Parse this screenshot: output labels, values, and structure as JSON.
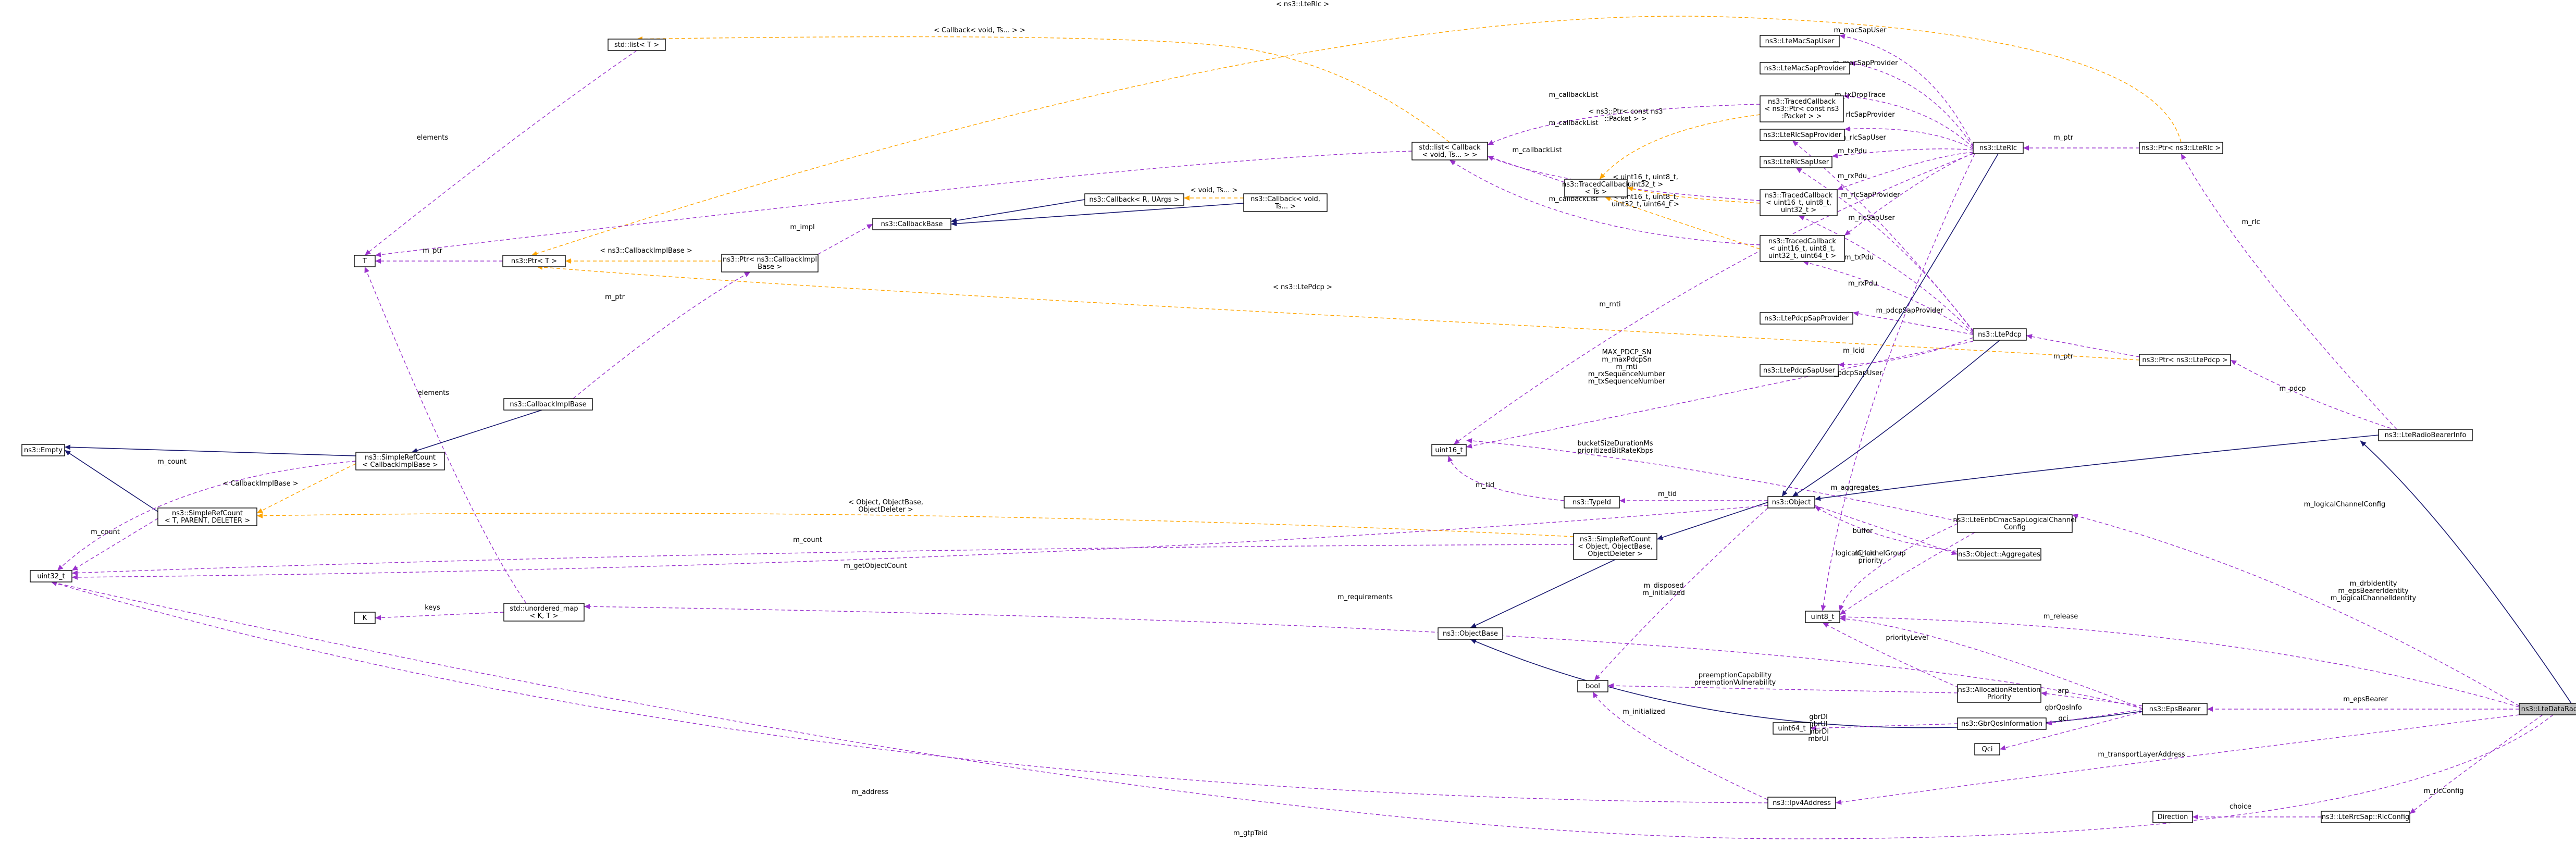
{
  "colors": {
    "usage_edge": "#9a32cd",
    "template_edge": "#ffa500",
    "inheritance_edge": "#191970",
    "highlight_fill": "#bfbfbf"
  },
  "nodes": [
    {
      "id": "uint32_t",
      "label": [
        "uint32_t"
      ]
    },
    {
      "id": "Empty",
      "label": [
        "ns3::Empty"
      ]
    },
    {
      "id": "SRC_generic",
      "label": [
        "ns3::SimpleRefCount",
        "< T, PARENT, DELETER >"
      ]
    },
    {
      "id": "K",
      "label": [
        "K"
      ]
    },
    {
      "id": "T",
      "label": [
        "T"
      ]
    },
    {
      "id": "stdlistT",
      "label": [
        "std::list< T >"
      ]
    },
    {
      "id": "PtrT",
      "label": [
        "ns3::Ptr< T >"
      ]
    },
    {
      "id": "unorderedmap",
      "label": [
        "std::unordered_map",
        "< K, T >"
      ]
    },
    {
      "id": "CBImplBase",
      "label": [
        "ns3::CallbackImplBase"
      ]
    },
    {
      "id": "SRC_CBImpl",
      "label": [
        "ns3::SimpleRefCount",
        "< CallbackImplBase >"
      ]
    },
    {
      "id": "PtrCBImpl",
      "label": [
        "ns3::Ptr< ns3::CallbackImpl",
        "Base >"
      ]
    },
    {
      "id": "CBBase",
      "label": [
        "ns3::CallbackBase"
      ]
    },
    {
      "id": "CallbackRU",
      "label": [
        "ns3::Callback< R, UArgs >"
      ]
    },
    {
      "id": "CallbackVoid",
      "label": [
        "ns3::Callback< void,",
        "Ts... >"
      ]
    },
    {
      "id": "stdlistCB",
      "label": [
        "std::list< Callback",
        "< void, Ts... > >"
      ]
    },
    {
      "id": "TCbTs",
      "label": [
        "ns3::TracedCallback",
        "< Ts >"
      ]
    },
    {
      "id": "LteMacSapUser",
      "label": [
        "ns3::LteMacSapUser"
      ]
    },
    {
      "id": "LteMacSapProvider",
      "label": [
        "ns3::LteMacSapProvider"
      ]
    },
    {
      "id": "TCbPacket",
      "label": [
        "ns3::TracedCallback",
        "< ns3::Ptr< const ns3",
        ":Packet > >"
      ]
    },
    {
      "id": "LteRlcSapProvider",
      "label": [
        "ns3::LteRlcSapProvider"
      ]
    },
    {
      "id": "LteRlcSapUser",
      "label": [
        "ns3::LteRlcSapUser"
      ]
    },
    {
      "id": "TCb3",
      "label": [
        "ns3::TracedCallback",
        "< uint16_t, uint8_t,",
        "uint32_t >"
      ]
    },
    {
      "id": "TCb4",
      "label": [
        "ns3::TracedCallback",
        "< uint16_t, uint8_t,",
        "uint32_t, uint64_t >"
      ]
    },
    {
      "id": "LtePdcpSapProvider",
      "label": [
        "ns3::LtePdcpSapProvider"
      ]
    },
    {
      "id": "LtePdcpSapUser",
      "label": [
        "ns3::LtePdcpSapUser"
      ]
    },
    {
      "id": "LteRlc",
      "label": [
        "ns3::LteRlc"
      ]
    },
    {
      "id": "LtePdcp",
      "label": [
        "ns3::LtePdcp"
      ]
    },
    {
      "id": "PtrLteRlc",
      "label": [
        "ns3::Ptr< ns3::LteRlc >"
      ]
    },
    {
      "id": "PtrLtePdcp",
      "label": [
        "ns3::Ptr< ns3::LtePdcp >"
      ]
    },
    {
      "id": "uint16_t",
      "label": [
        "uint16_t"
      ]
    },
    {
      "id": "TypeId",
      "label": [
        "ns3::TypeId"
      ]
    },
    {
      "id": "Object",
      "label": [
        "ns3::Object"
      ]
    },
    {
      "id": "SRC_Object",
      "label": [
        "ns3::SimpleRefCount",
        "< Object, ObjectBase,",
        "ObjectDeleter >"
      ]
    },
    {
      "id": "ObjectBase",
      "label": [
        "ns3::ObjectBase"
      ]
    },
    {
      "id": "LCConfig",
      "label": [
        "ns3::LteEnbCmacSapLogicalChannel",
        "Config"
      ]
    },
    {
      "id": "Aggregates",
      "label": [
        "ns3::Object::Aggregates"
      ]
    },
    {
      "id": "uint8_t",
      "label": [
        "uint8_t"
      ]
    },
    {
      "id": "bool",
      "label": [
        "bool"
      ]
    },
    {
      "id": "uint64_t",
      "label": [
        "uint64_t"
      ]
    },
    {
      "id": "ARP",
      "label": [
        "ns3::AllocationRetention",
        "Priority"
      ]
    },
    {
      "id": "GbrQos",
      "label": [
        "ns3::GbrQosInformation"
      ]
    },
    {
      "id": "Qci",
      "label": [
        "Qci"
      ]
    },
    {
      "id": "EpsBearer",
      "label": [
        "ns3::EpsBearer"
      ]
    },
    {
      "id": "Ipv4Address",
      "label": [
        "ns3::Ipv4Address"
      ]
    },
    {
      "id": "Direction",
      "label": [
        "Direction"
      ]
    },
    {
      "id": "RlcConfig",
      "label": [
        "ns3::LteRrcSap::RlcConfig"
      ]
    },
    {
      "id": "LteRBInfo",
      "label": [
        "ns3::LteRadioBearerInfo"
      ]
    },
    {
      "id": "LteDataRBInfo",
      "label": [
        "ns3::LteDataRadioBearerInfo"
      ]
    }
  ],
  "edges": [
    {
      "type": "template",
      "label": [
        "< ns3::LteRlc >"
      ]
    },
    {
      "type": "template",
      "label": [
        "< Callback< void, Ts... > >"
      ]
    },
    {
      "type": "usage",
      "label": [
        "elements"
      ]
    },
    {
      "type": "usage",
      "label": [
        "elements"
      ]
    },
    {
      "type": "usage",
      "label": [
        "elements"
      ]
    },
    {
      "type": "usage",
      "label": [
        "m_ptr"
      ]
    },
    {
      "type": "template",
      "label": [
        "< ns3::CallbackImplBase >"
      ]
    },
    {
      "type": "usage",
      "label": [
        "m_impl"
      ]
    },
    {
      "type": "usage",
      "label": [
        "m_ptr"
      ]
    },
    {
      "type": "template",
      "label": [
        "< void, Ts... >"
      ]
    },
    {
      "type": "usage",
      "label": [
        "m_callbackList"
      ]
    },
    {
      "type": "usage",
      "label": [
        "m_callbackList"
      ]
    },
    {
      "type": "usage",
      "label": [
        "m_callbackList"
      ]
    },
    {
      "type": "usage",
      "label": [
        "m_callbackList"
      ]
    },
    {
      "type": "template",
      "label": [
        "< ns3::Ptr< const ns3",
        "::Packet > >"
      ]
    },
    {
      "type": "template",
      "label": [
        "< uint16_t, uint8_t,",
        "uint32_t >"
      ]
    },
    {
      "type": "template",
      "label": [
        "< uint16_t, uint8_t,",
        "uint32_t, uint64_t >"
      ]
    },
    {
      "type": "usage",
      "label": [
        "m_macSapUser"
      ]
    },
    {
      "type": "usage",
      "label": [
        "m_macSapProvider"
      ]
    },
    {
      "type": "usage",
      "label": [
        "m_txDropTrace"
      ]
    },
    {
      "type": "usage",
      "label": [
        "m_rlcSapProvider"
      ]
    },
    {
      "type": "usage",
      "label": [
        "m_rlcSapUser"
      ]
    },
    {
      "type": "usage",
      "label": [
        "m_txPdu"
      ]
    },
    {
      "type": "usage",
      "label": [
        "m_rxPdu"
      ]
    },
    {
      "type": "usage",
      "label": [
        "m_rlcSapProvider"
      ]
    },
    {
      "type": "usage",
      "label": [
        "m_rlcSapUser"
      ]
    },
    {
      "type": "usage",
      "label": [
        "m_txPdu"
      ]
    },
    {
      "type": "usage",
      "label": [
        "m_rxPdu"
      ]
    },
    {
      "type": "usage",
      "label": [
        "m_pdcpSapProvider"
      ]
    },
    {
      "type": "usage",
      "label": [
        "m_pdcpSapUser"
      ]
    },
    {
      "type": "usage",
      "label": [
        "m_ptr"
      ]
    },
    {
      "type": "usage",
      "label": [
        "m_ptr"
      ]
    },
    {
      "type": "template",
      "label": [
        "< ns3::LtePdcp >"
      ]
    },
    {
      "type": "usage",
      "label": [
        "m_rnti"
      ]
    },
    {
      "type": "usage",
      "label": [
        "MAX_PDCP_SN",
        "m_maxPdcpSn",
        "m_rnti",
        "m_rxSequenceNumber",
        "m_txSequenceNumber"
      ]
    },
    {
      "type": "usage",
      "label": [
        "m_lcid"
      ]
    },
    {
      "type": "usage",
      "label": [
        "m_tid"
      ]
    },
    {
      "type": "usage",
      "label": [
        "bucketSizeDurationMs",
        "prioritizedBitRateKbps"
      ]
    },
    {
      "type": "usage",
      "label": [
        "m_tid"
      ]
    },
    {
      "type": "inheritance",
      "label": []
    },
    {
      "type": "inheritance",
      "label": []
    },
    {
      "type": "inheritance",
      "label": []
    },
    {
      "type": "inheritance",
      "label": []
    },
    {
      "type": "inheritance",
      "label": []
    },
    {
      "type": "inheritance",
      "label": []
    },
    {
      "type": "inheritance",
      "label": []
    },
    {
      "type": "inheritance",
      "label": []
    },
    {
      "type": "inheritance",
      "label": []
    },
    {
      "type": "inheritance",
      "label": []
    },
    {
      "type": "inheritance",
      "label": []
    },
    {
      "type": "inheritance",
      "label": []
    },
    {
      "type": "usage",
      "label": [
        "m_count"
      ]
    },
    {
      "type": "usage",
      "label": [
        "m_count"
      ]
    },
    {
      "type": "usage",
      "label": [
        "m_count"
      ]
    },
    {
      "type": "usage",
      "label": [
        "m_getObjectCount"
      ]
    },
    {
      "type": "template",
      "label": [
        "< CallbackImplBase >"
      ]
    },
    {
      "type": "template",
      "label": [
        "< Object, ObjectBase,",
        "ObjectDeleter >"
      ]
    },
    {
      "type": "usage",
      "label": [
        "keys"
      ]
    },
    {
      "type": "usage",
      "label": [
        "m_aggregates"
      ]
    },
    {
      "type": "usage",
      "label": [
        "m_lcid"
      ]
    },
    {
      "type": "usage",
      "label": [
        "buffer"
      ]
    },
    {
      "type": "usage",
      "label": [
        "logicalChannelGroup",
        "priority"
      ]
    },
    {
      "type": "usage",
      "label": [
        "m_disposed",
        "m_initialized"
      ]
    },
    {
      "type": "usage",
      "label": [
        "m_requirements"
      ]
    },
    {
      "type": "usage",
      "label": [
        "m_logicalChannelConfig"
      ]
    },
    {
      "type": "usage",
      "label": [
        "m_drbIdentity",
        "m_epsBearerIdentity",
        "m_logicalChannelIdentity"
      ]
    },
    {
      "type": "usage",
      "label": [
        "m_release"
      ]
    },
    {
      "type": "usage",
      "label": [
        "priorityLevel"
      ]
    },
    {
      "type": "usage",
      "label": [
        "preemptionCapability",
        "preemptionVulnerability"
      ]
    },
    {
      "type": "usage",
      "label": [
        "arp"
      ]
    },
    {
      "type": "usage",
      "label": [
        "gbrDl",
        "gbrUl",
        "mbrDl",
        "mbrUl"
      ]
    },
    {
      "type": "usage",
      "label": [
        "gbrQosInfo"
      ]
    },
    {
      "type": "usage",
      "label": [
        "qci"
      ]
    },
    {
      "type": "usage",
      "label": [
        "m_epsBearer"
      ]
    },
    {
      "type": "usage",
      "label": [
        "m_initialized"
      ]
    },
    {
      "type": "usage",
      "label": [
        "m_address"
      ]
    },
    {
      "type": "usage",
      "label": [
        "m_transportLayerAddress"
      ]
    },
    {
      "type": "usage",
      "label": [
        "choice"
      ]
    },
    {
      "type": "usage",
      "label": [
        "m_rlcConfig"
      ]
    },
    {
      "type": "usage",
      "label": [
        "m_gtpTeid"
      ]
    },
    {
      "type": "usage",
      "label": [
        "m_rlc"
      ]
    },
    {
      "type": "usage",
      "label": [
        "m_pdcp"
      ]
    },
    {
      "type": "usage",
      "label": [
        "m_ptr"
      ]
    }
  ]
}
